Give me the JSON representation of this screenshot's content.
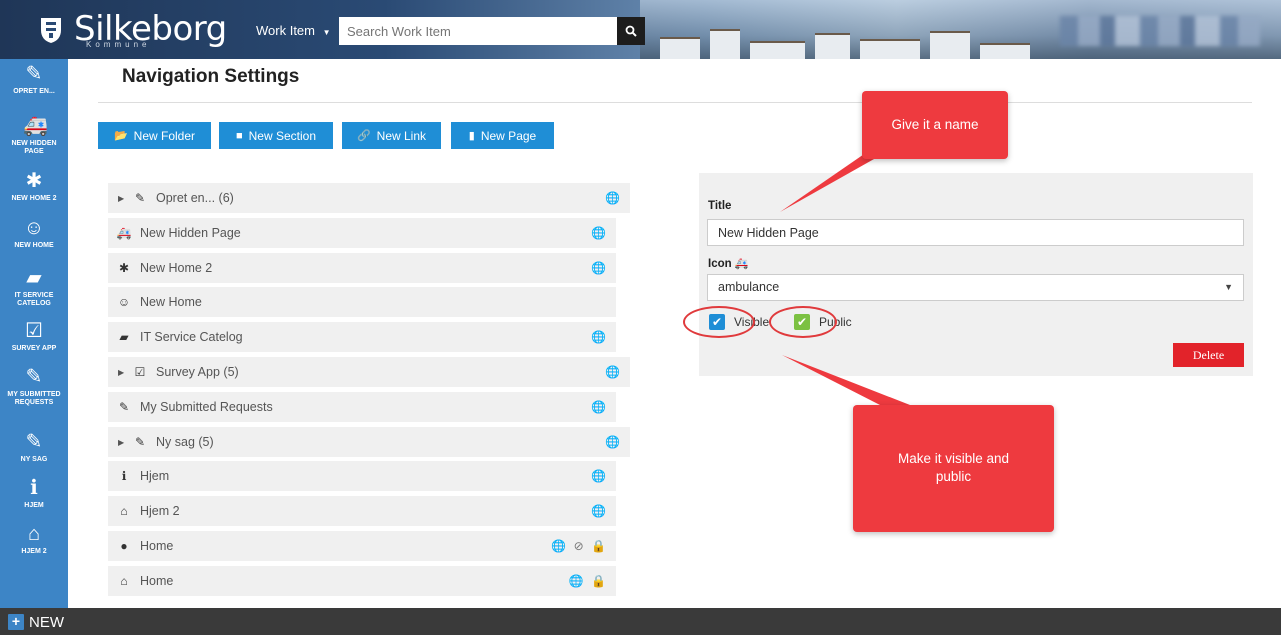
{
  "header": {
    "logo_text": "Silkeborg",
    "logo_sub": "Kommune",
    "workitem_label": "Work Item",
    "search_placeholder": "Search Work Item"
  },
  "sidebar": {
    "items": [
      {
        "icon": "pencil-icon",
        "glyph": "✎",
        "label": "OPRET EN..."
      },
      {
        "icon": "ambulance-icon",
        "glyph": "🚑",
        "label": "NEW HIDDEN PAGE"
      },
      {
        "icon": "asterisk-icon",
        "glyph": "✱",
        "label": "NEW HOME 2"
      },
      {
        "icon": "smile-icon",
        "glyph": "☺",
        "label": "NEW HOME"
      },
      {
        "icon": "book-icon",
        "glyph": "▰",
        "label": "IT SERVICE CATELOG"
      },
      {
        "icon": "check-square-icon",
        "glyph": "☑",
        "label": "SURVEY APP"
      },
      {
        "icon": "edit-icon",
        "glyph": "✎",
        "label": "MY SUBMITTED REQUESTS"
      },
      {
        "icon": "pencil-icon",
        "glyph": "✎",
        "label": "NY SAG"
      },
      {
        "icon": "info-icon",
        "glyph": "ℹ",
        "label": "HJEM"
      },
      {
        "icon": "home-icon",
        "glyph": "⌂",
        "label": "HJEM 2"
      }
    ]
  },
  "bottom": {
    "new_label": "NEW"
  },
  "main": {
    "page_title": "Navigation Settings",
    "toolbar": {
      "new_folder": "New Folder",
      "new_section": "New Section",
      "new_link": "New Link",
      "new_page": "New Page"
    },
    "tree": [
      {
        "label": "Opret en... (6)",
        "icon": "pencil-icon",
        "glyph": "✎",
        "caret": true,
        "status": "🌐"
      },
      {
        "label": "New Hidden Page",
        "icon": "ambulance-icon",
        "glyph": "🚑",
        "caret": false,
        "status": "🌐"
      },
      {
        "label": "New Home 2",
        "icon": "asterisk-icon",
        "glyph": "✱",
        "caret": false,
        "status": "🌐"
      },
      {
        "label": "New Home",
        "icon": "smile-icon",
        "glyph": "☺",
        "caret": false,
        "status": ""
      },
      {
        "label": "IT Service Catelog",
        "icon": "book-icon",
        "glyph": "▰",
        "caret": false,
        "status": "🌐"
      },
      {
        "label": "Survey App (5)",
        "icon": "check-square-icon",
        "glyph": "☑",
        "caret": true,
        "status": "🌐"
      },
      {
        "label": "My Submitted Requests",
        "icon": "edit-icon",
        "glyph": "✎",
        "caret": false,
        "status": "🌐"
      },
      {
        "label": "Ny sag (5)",
        "icon": "pencil-icon",
        "glyph": "✎",
        "caret": true,
        "status": "🌐"
      },
      {
        "label": "Hjem",
        "icon": "info-icon",
        "glyph": "ℹ",
        "caret": false,
        "status": "🌐"
      },
      {
        "label": "Hjem 2",
        "icon": "home-icon",
        "glyph": "⌂",
        "caret": false,
        "status": "🌐"
      },
      {
        "label": "Home",
        "icon": "bomb-icon",
        "glyph": "●",
        "caret": false,
        "status": "🌐 ⊘ 🔒"
      },
      {
        "label": "Home",
        "icon": "home-icon",
        "glyph": "⌂",
        "caret": false,
        "status": "🌐 🔒"
      }
    ]
  },
  "panel": {
    "title_label": "Title",
    "title_value": "New Hidden Page",
    "icon_label": "Icon",
    "icon_value": "ambulance",
    "visible_label": "Visible",
    "public_label": "Public",
    "delete_label": "Delete"
  },
  "callouts": {
    "name": "Give it a name",
    "visible": "Make it visible and public"
  },
  "colors": {
    "accent": "#1f8ed6",
    "sidebar": "#3d85c6",
    "callout": "#ee3a3f",
    "delete": "#e2232a",
    "public_check": "#7cc142"
  }
}
